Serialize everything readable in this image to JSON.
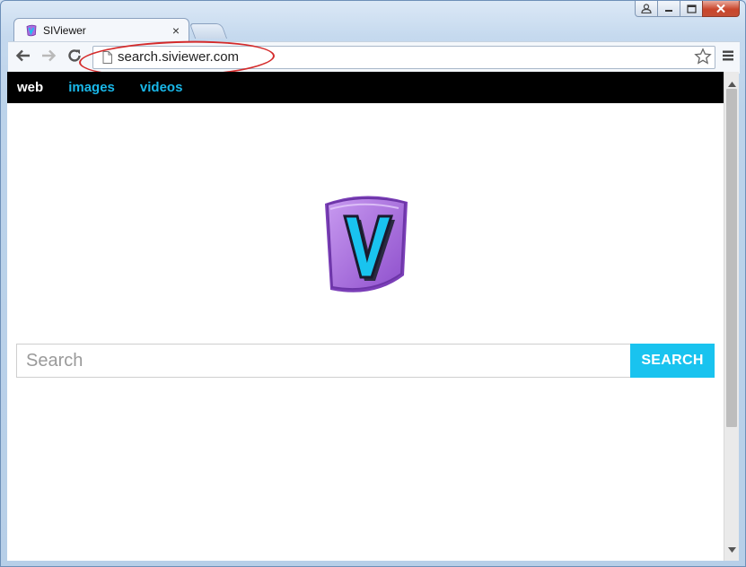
{
  "browser": {
    "tab": {
      "title": "SIViewer",
      "close_glyph": "×",
      "favicon": "siviewer-v-icon"
    },
    "address_bar": {
      "url": "search.siviewer.com"
    },
    "icons": [
      "back-arrow-icon",
      "forward-arrow-icon",
      "reload-icon",
      "page-icon",
      "bookmark-star-icon",
      "menu-icon",
      "user-icon",
      "minimize-icon",
      "maximize-icon",
      "close-icon"
    ]
  },
  "site": {
    "nav": [
      {
        "label": "web"
      },
      {
        "label": "images"
      },
      {
        "label": "videos"
      }
    ],
    "search": {
      "placeholder": "Search",
      "button_label": "SEARCH"
    },
    "logo_letter": "V"
  },
  "colors": {
    "accent": "#19c3ef",
    "nav_bar": "#000000",
    "logo_purple": "#a86ce0",
    "annotation_ring": "#d42b2b"
  }
}
